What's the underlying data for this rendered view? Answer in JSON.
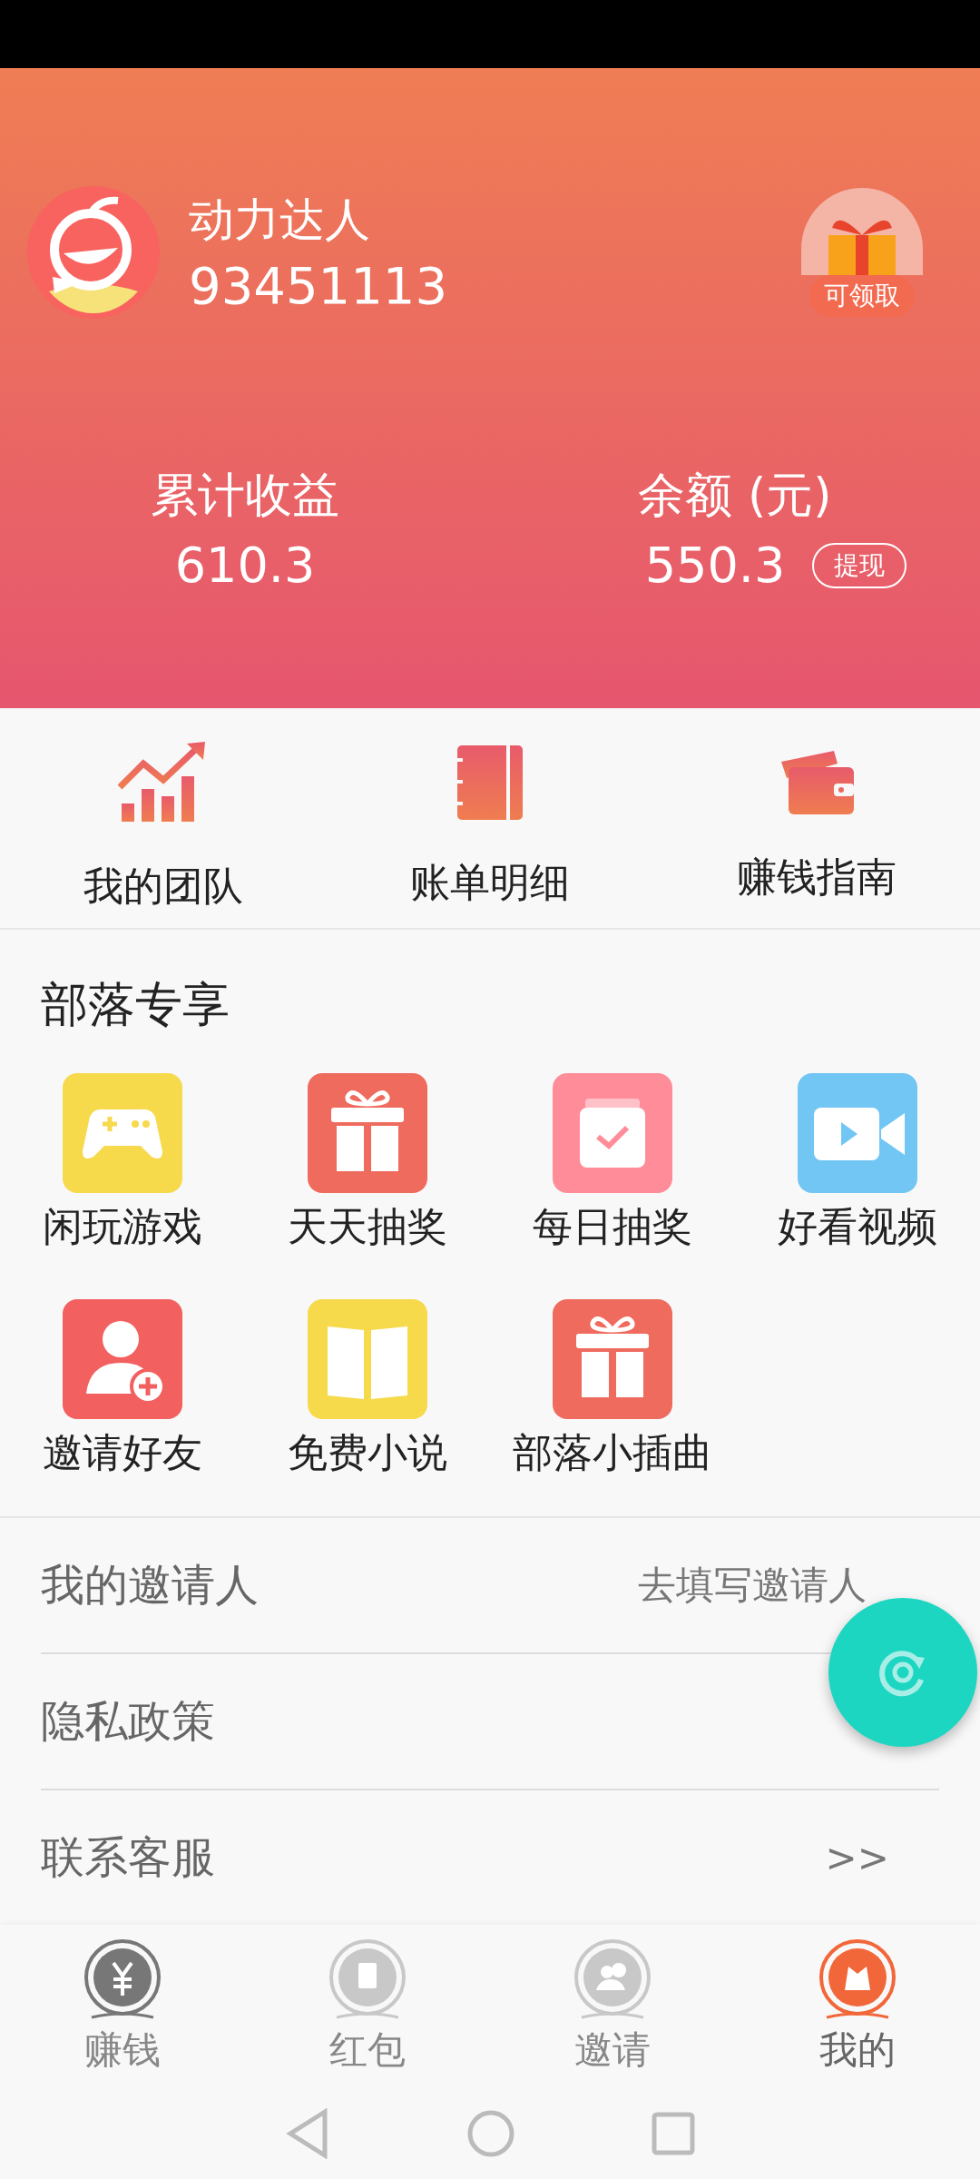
{
  "profile": {
    "name": "动力达人",
    "id": "93451113",
    "gift_badge": "可领取"
  },
  "stats": [
    {
      "label": "累计收益",
      "value": "610.3"
    },
    {
      "label": "余额 (元)",
      "value": "550.3",
      "action": "提现"
    }
  ],
  "quick_links": [
    {
      "label": "我的团队",
      "kind": "chart"
    },
    {
      "label": "账单明细",
      "kind": "notebook"
    },
    {
      "label": "赚钱指南",
      "kind": "wallet"
    }
  ],
  "section": {
    "title": "部落专享",
    "items": [
      {
        "label": "闲玩游戏",
        "kind": "gamepad",
        "color": "#f7d94c"
      },
      {
        "label": "天天抽奖",
        "kind": "gift",
        "color": "#ee6b5e"
      },
      {
        "label": "每日抽奖",
        "kind": "calendar",
        "color": "#ff8d99"
      },
      {
        "label": "好看视频",
        "kind": "video",
        "color": "#72c6f4"
      },
      {
        "label": "邀请好友",
        "kind": "user-add",
        "color": "#f2605f"
      },
      {
        "label": "免费小说",
        "kind": "book",
        "color": "#f7d94c"
      },
      {
        "label": "部落小插曲",
        "kind": "gift",
        "color": "#ee6b5e"
      }
    ]
  },
  "menu": [
    {
      "label": "我的邀请人",
      "value": "去填写邀请人"
    },
    {
      "label": "隐私政策"
    },
    {
      "label": "联系客服",
      "value": ">>"
    }
  ],
  "bottom_nav": [
    {
      "label": "赚钱",
      "kind": "yuan",
      "selected": false
    },
    {
      "label": "红包",
      "kind": "envelope",
      "selected": false
    },
    {
      "label": "邀请",
      "kind": "people",
      "selected": false
    },
    {
      "label": "我的",
      "kind": "bag",
      "selected": true
    }
  ]
}
